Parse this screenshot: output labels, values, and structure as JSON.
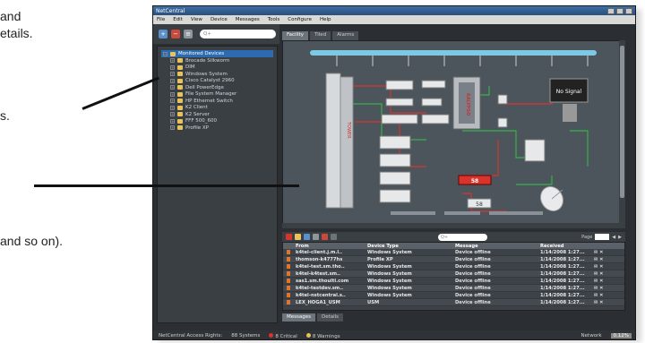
{
  "doc": {
    "frag1": "and",
    "frag2": "etails.",
    "frag3": "s.",
    "frag4": "and so on)."
  },
  "window": {
    "title": "NetCentral",
    "menu": [
      "File",
      "Edit",
      "View",
      "Device",
      "Messages",
      "Tools",
      "Configure",
      "Help"
    ],
    "search_placeholder": "Q+"
  },
  "tree": {
    "root": "Monitored Devices",
    "items": [
      "Brocade Silkworm",
      "DIM",
      "Windows System",
      "Cisco Catalyst 2960",
      "Dell PowerEdge",
      "File System Manager",
      "HP Ethernet Switch",
      "K2 Client",
      "K2 Server",
      "FFF 500_600",
      "Profile XP"
    ]
  },
  "view_tabs": [
    "Facility",
    "Tiled",
    "Alarms"
  ],
  "canvas": {
    "labels": {
      "kalypso": "KALYPSO",
      "no_signal": "No Signal",
      "tower": "TOWER",
      "alert_value": "58",
      "ok_value": "58"
    }
  },
  "grid": {
    "search_placeholder": "Q+",
    "page_label": "Page",
    "columns": [
      "From",
      "Device Type",
      "Message",
      "Received"
    ],
    "rows": [
      {
        "from": "k4tel-client.j.m.l..",
        "type": "Windows System",
        "message": "Device offline",
        "received": "1/14/2008 1:27..."
      },
      {
        "from": "thomson-k4777hs",
        "type": "Profile XP",
        "message": "Device offline",
        "received": "1/14/2008 1:27..."
      },
      {
        "from": "k4tel-test.sm.tho..",
        "type": "Windows System",
        "message": "Device offline",
        "received": "1/14/2008 1:27..."
      },
      {
        "from": "k4tel-k4test.sm..",
        "type": "Windows System",
        "message": "Device offline",
        "received": "1/14/2008 1:27..."
      },
      {
        "from": "sas1.sm.thoulti.com",
        "type": "Windows System",
        "message": "Device offline",
        "received": "1/14/2008 1:27..."
      },
      {
        "from": "k4tel-testdev.sm..",
        "type": "Windows System",
        "message": "Device offline",
        "received": "1/14/2008 1:27..."
      },
      {
        "from": "k4tel-nstcentral.s..",
        "type": "Windows System",
        "message": "Device offline",
        "received": "1/14/2008 1:27..."
      },
      {
        "from": "LEX_HOGA1_USM",
        "type": "USM",
        "message": "Device offline",
        "received": "1/14/2008 1:27..."
      }
    ]
  },
  "bottom_tabs": [
    "Messages",
    "Details"
  ],
  "status": {
    "label": "NetCentral Access Rights:",
    "systems": "88 Systems",
    "critical": "8 Critical",
    "warnings": "8 Warnings",
    "network_label": "Network",
    "network_value": "0.12%"
  },
  "colors": {
    "accent": "#2d6bb0",
    "critical": "#d9342b",
    "warning": "#e8c25a",
    "bus": "#7ec8e3",
    "link_green": "#34b34a",
    "link_red": "#d9342b"
  }
}
